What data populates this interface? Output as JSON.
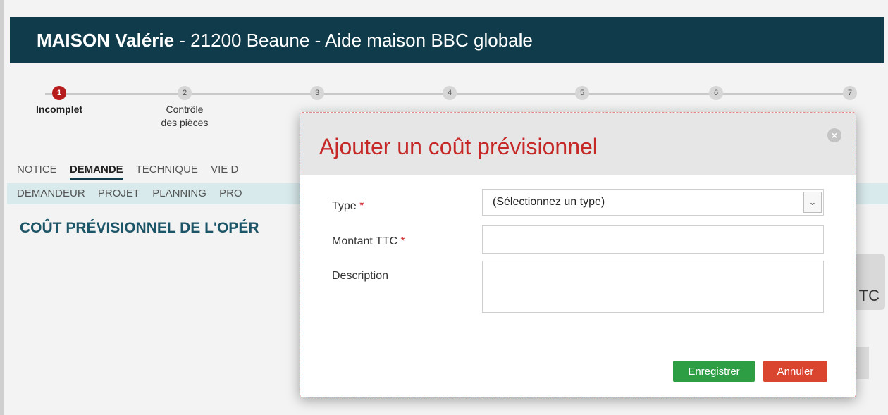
{
  "header": {
    "name": "MAISON Valérie",
    "rest": " - 21200 Beaune  - Aide maison BBC globale"
  },
  "stepper": {
    "steps": [
      {
        "number": "1",
        "line1": "Incomplet",
        "line2": ""
      },
      {
        "number": "2",
        "line1": "Contrôle",
        "line2": "des pièces"
      },
      {
        "number": "3",
        "line1": "",
        "line2": ""
      },
      {
        "number": "4",
        "line1": "",
        "line2": ""
      },
      {
        "number": "5",
        "line1": "",
        "line2": ""
      },
      {
        "number": "6",
        "line1": "",
        "line2": ""
      },
      {
        "number": "7",
        "line1": "",
        "line2": ""
      }
    ]
  },
  "tabs": [
    "NOTICE",
    "DEMANDE",
    "TECHNIQUE",
    "VIE D"
  ],
  "active_tab": "DEMANDE",
  "subtabs": [
    "DEMANDEUR",
    "PROJET",
    "PLANNING",
    "PRO"
  ],
  "section_title": "COÛT PRÉVISIONNEL DE L'OPÉR",
  "background_card_text": "TC",
  "modal": {
    "title": "Ajouter un coût prévisionnel",
    "close_icon": "×",
    "fields": {
      "type_label": "Type",
      "type_selected": "(Sélectionnez un type)",
      "amount_label": "Montant TTC",
      "amount_value": "",
      "description_label": "Description",
      "description_value": ""
    },
    "required_marker": "*",
    "save_label": "Enregistrer",
    "cancel_label": "Annuler"
  },
  "colors": {
    "header_bg": "#0f3b4a",
    "accent_red": "#c62828",
    "save_green": "#2e9e44",
    "cancel_red": "#d9452f"
  }
}
